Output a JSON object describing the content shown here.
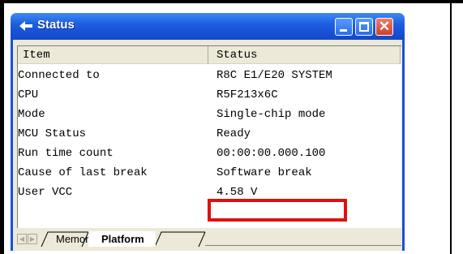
{
  "window": {
    "title": "Status",
    "icon": "arrow-icon"
  },
  "table": {
    "columns": [
      "Item",
      "Status"
    ],
    "rows": [
      {
        "item": "Connected to",
        "status": "R8C E1/E20 SYSTEM"
      },
      {
        "item": "CPU",
        "status": "R5F213x6C"
      },
      {
        "item": "Mode",
        "status": "Single-chip mode"
      },
      {
        "item": "MCU Status",
        "status": "Ready"
      },
      {
        "item": "Run time count",
        "status": "00:00:00.000.100"
      },
      {
        "item": "Cause of last break",
        "status": "Software break"
      },
      {
        "item": "User VCC",
        "status": "4.58 V"
      }
    ],
    "highlighted_row": 5,
    "highlight_color": "#e01010"
  },
  "tabs": [
    {
      "label": "Memory",
      "active": false
    },
    {
      "label": "Platform",
      "active": true
    }
  ],
  "colors": {
    "titlebar": "#1f5fe0",
    "close_button": "#d0402a"
  }
}
